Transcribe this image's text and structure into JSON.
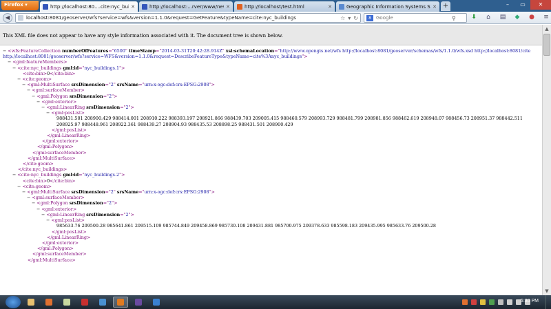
{
  "browser": {
    "app_button": "Firefox",
    "tabs": [
      {
        "label": "http://localhost:80....cite:nyc_buildings",
        "active": true,
        "color": "#3355bb"
      },
      {
        "label": "http://localhost:...rver/www/new.html",
        "active": false,
        "color": "#3355bb"
      },
      {
        "label": "http://localhost/test.html",
        "active": false,
        "color": "#e06020"
      },
      {
        "label": "Geographic Information Systems Stac...",
        "active": false,
        "color": "#5a8ad0"
      }
    ],
    "new_tab": "+",
    "url_host": "localhost",
    "url_rest": ":8081/geoserver/wfs?service=wfs&version=1.1.0&request=GetFeature&typeName=cite:nyc_buildings",
    "search_placeholder": "Google",
    "search_engine_letter": "8"
  },
  "info_message": "This XML file does not appear to have any style information associated with it. The document tree is shown below.",
  "xml_lines": [
    {
      "indent": 0,
      "minus": true,
      "wrap": true,
      "parts": [
        {
          "c": "tg",
          "t": "<wfs:FeatureCollection "
        },
        {
          "c": "an",
          "t": "numberOfFeatures"
        },
        {
          "c": "tg",
          "t": "=\""
        },
        {
          "c": "av",
          "t": "6500"
        },
        {
          "c": "tg",
          "t": "\" "
        },
        {
          "c": "an",
          "t": "timeStamp"
        },
        {
          "c": "tg",
          "t": "=\""
        },
        {
          "c": "av",
          "t": "2014-03-31T20:42:28.914Z"
        },
        {
          "c": "tg",
          "t": "\" "
        },
        {
          "c": "an",
          "t": "xsi:schemaLocation"
        },
        {
          "c": "tg",
          "t": "=\""
        },
        {
          "c": "av",
          "t": "http://www.opengis.net/wfs http://localhost:8081/geoserver/schemas/wfs/1.1.0/wfs.xsd http://localhost:8081/cite http://localhost:8081/geoserver/wfs?service=WFS&version=1.1.0&request=DescribeFeatureType&typeName=cite%3Anyc_buildings"
        },
        {
          "c": "tg",
          "t": "\">"
        }
      ]
    },
    {
      "indent": 1,
      "minus": true,
      "parts": [
        {
          "c": "tg",
          "t": "<gml:featureMembers>"
        }
      ]
    },
    {
      "indent": 2,
      "minus": true,
      "parts": [
        {
          "c": "tg",
          "t": "<cite:nyc_buildings "
        },
        {
          "c": "an",
          "t": "gml:id"
        },
        {
          "c": "tg",
          "t": "=\""
        },
        {
          "c": "av",
          "t": "nyc_buildings.1"
        },
        {
          "c": "tg",
          "t": "\">"
        }
      ]
    },
    {
      "indent": 3,
      "minus": false,
      "parts": [
        {
          "c": "tg",
          "t": "<cite:bin>"
        },
        {
          "c": "tx",
          "t": "0"
        },
        {
          "c": "tg",
          "t": "</cite:bin>"
        }
      ]
    },
    {
      "indent": 3,
      "minus": true,
      "parts": [
        {
          "c": "tg",
          "t": "<cite:geom>"
        }
      ]
    },
    {
      "indent": 4,
      "minus": true,
      "parts": [
        {
          "c": "tg",
          "t": "<gml:MultiSurface "
        },
        {
          "c": "an",
          "t": "srsDimension"
        },
        {
          "c": "tg",
          "t": "=\""
        },
        {
          "c": "av",
          "t": "2"
        },
        {
          "c": "tg",
          "t": "\" "
        },
        {
          "c": "an",
          "t": "srsName"
        },
        {
          "c": "tg",
          "t": "=\""
        },
        {
          "c": "av",
          "t": "urn:x-ogc:def:crs:EPSG:2908"
        },
        {
          "c": "tg",
          "t": "\">"
        }
      ]
    },
    {
      "indent": 5,
      "minus": true,
      "parts": [
        {
          "c": "tg",
          "t": "<gml:surfaceMember>"
        }
      ]
    },
    {
      "indent": 6,
      "minus": true,
      "parts": [
        {
          "c": "tg",
          "t": "<gml:Polygon "
        },
        {
          "c": "an",
          "t": "srsDimension"
        },
        {
          "c": "tg",
          "t": "=\""
        },
        {
          "c": "av",
          "t": "2"
        },
        {
          "c": "tg",
          "t": "\">"
        }
      ]
    },
    {
      "indent": 7,
      "minus": true,
      "parts": [
        {
          "c": "tg",
          "t": "<gml:exterior>"
        }
      ]
    },
    {
      "indent": 8,
      "minus": true,
      "parts": [
        {
          "c": "tg",
          "t": "<gml:LinearRing "
        },
        {
          "c": "an",
          "t": "srsDimension"
        },
        {
          "c": "tg",
          "t": "=\""
        },
        {
          "c": "av",
          "t": "2"
        },
        {
          "c": "tg",
          "t": "\">"
        }
      ]
    },
    {
      "indent": 9,
      "minus": true,
      "parts": [
        {
          "c": "tg",
          "t": "<gml:posList>"
        }
      ]
    },
    {
      "indent": 10,
      "minus": false,
      "wrap": true,
      "parts": [
        {
          "c": "tx",
          "t": "988431.501 208900.429 988414.001 208910.222 988393.197 208921.866 988439.703 209005.415 988460.579 208993.729 988481.799 208981.856 988462.619 208948.07 988456.73 208951.37 988442.511 208925.97 988448.961 208922.361 988439.27 208904.93 988435.53 208898.25 988431.501 208900.429"
        }
      ]
    },
    {
      "indent": 9,
      "minus": false,
      "parts": [
        {
          "c": "tg",
          "t": "</gml:posList>"
        }
      ]
    },
    {
      "indent": 8,
      "minus": false,
      "parts": [
        {
          "c": "tg",
          "t": "</gml:LinearRing>"
        }
      ]
    },
    {
      "indent": 7,
      "minus": false,
      "parts": [
        {
          "c": "tg",
          "t": "</gml:exterior>"
        }
      ]
    },
    {
      "indent": 6,
      "minus": false,
      "parts": [
        {
          "c": "tg",
          "t": "</gml:Polygon>"
        }
      ]
    },
    {
      "indent": 5,
      "minus": false,
      "parts": [
        {
          "c": "tg",
          "t": "</gml:surfaceMember>"
        }
      ]
    },
    {
      "indent": 4,
      "minus": false,
      "parts": [
        {
          "c": "tg",
          "t": "</gml:MultiSurface>"
        }
      ]
    },
    {
      "indent": 3,
      "minus": false,
      "parts": [
        {
          "c": "tg",
          "t": "</cite:geom>"
        }
      ]
    },
    {
      "indent": 2,
      "minus": false,
      "parts": [
        {
          "c": "tg",
          "t": "</cite:nyc_buildings>"
        }
      ]
    },
    {
      "indent": 2,
      "minus": true,
      "parts": [
        {
          "c": "tg",
          "t": "<cite:nyc_buildings "
        },
        {
          "c": "an",
          "t": "gml:id"
        },
        {
          "c": "tg",
          "t": "=\""
        },
        {
          "c": "av",
          "t": "nyc_buildings.2"
        },
        {
          "c": "tg",
          "t": "\">"
        }
      ]
    },
    {
      "indent": 3,
      "minus": false,
      "parts": [
        {
          "c": "tg",
          "t": "<cite:bin>"
        },
        {
          "c": "tx",
          "t": "0"
        },
        {
          "c": "tg",
          "t": "</cite:bin>"
        }
      ]
    },
    {
      "indent": 3,
      "minus": true,
      "parts": [
        {
          "c": "tg",
          "t": "<cite:geom>"
        }
      ]
    },
    {
      "indent": 4,
      "minus": true,
      "parts": [
        {
          "c": "tg",
          "t": "<gml:MultiSurface "
        },
        {
          "c": "an",
          "t": "srsDimension"
        },
        {
          "c": "tg",
          "t": "=\""
        },
        {
          "c": "av",
          "t": "2"
        },
        {
          "c": "tg",
          "t": "\" "
        },
        {
          "c": "an",
          "t": "srsName"
        },
        {
          "c": "tg",
          "t": "=\""
        },
        {
          "c": "av",
          "t": "urn:x-ogc:def:crs:EPSG:2908"
        },
        {
          "c": "tg",
          "t": "\">"
        }
      ]
    },
    {
      "indent": 5,
      "minus": true,
      "parts": [
        {
          "c": "tg",
          "t": "<gml:surfaceMember>"
        }
      ]
    },
    {
      "indent": 6,
      "minus": true,
      "parts": [
        {
          "c": "tg",
          "t": "<gml:Polygon "
        },
        {
          "c": "an",
          "t": "srsDimension"
        },
        {
          "c": "tg",
          "t": "=\""
        },
        {
          "c": "av",
          "t": "2"
        },
        {
          "c": "tg",
          "t": "\">"
        }
      ]
    },
    {
      "indent": 7,
      "minus": true,
      "parts": [
        {
          "c": "tg",
          "t": "<gml:exterior>"
        }
      ]
    },
    {
      "indent": 8,
      "minus": true,
      "parts": [
        {
          "c": "tg",
          "t": "<gml:LinearRing "
        },
        {
          "c": "an",
          "t": "srsDimension"
        },
        {
          "c": "tg",
          "t": "=\""
        },
        {
          "c": "av",
          "t": "2"
        },
        {
          "c": "tg",
          "t": "\">"
        }
      ]
    },
    {
      "indent": 9,
      "minus": true,
      "parts": [
        {
          "c": "tg",
          "t": "<gml:posList>"
        }
      ]
    },
    {
      "indent": 10,
      "minus": false,
      "wrap": true,
      "parts": [
        {
          "c": "tx",
          "t": "985633.76 209500.28 985641.861 209515.109 985744.849 209458.869 985730.108 209431.881 985700.975 209378.633 985598.183 209435.995 985633.76 209500.28"
        }
      ]
    },
    {
      "indent": 9,
      "minus": false,
      "parts": [
        {
          "c": "tg",
          "t": "</gml:posList>"
        }
      ]
    },
    {
      "indent": 8,
      "minus": false,
      "parts": [
        {
          "c": "tg",
          "t": "</gml:LinearRing>"
        }
      ]
    },
    {
      "indent": 7,
      "minus": false,
      "parts": [
        {
          "c": "tg",
          "t": "</gml:exterior>"
        }
      ]
    },
    {
      "indent": 6,
      "minus": false,
      "parts": [
        {
          "c": "tg",
          "t": "</gml:Polygon>"
        }
      ]
    },
    {
      "indent": 5,
      "minus": false,
      "parts": [
        {
          "c": "tg",
          "t": "</gml:surfaceMember>"
        }
      ]
    },
    {
      "indent": 4,
      "minus": false,
      "parts": [
        {
          "c": "tg",
          "t": "</gml:MultiSurface>"
        }
      ]
    }
  ],
  "taskbar": {
    "apps": [
      {
        "name": "explorer-icon",
        "color": "#e8c070",
        "active": false
      },
      {
        "name": "media-player-icon",
        "color": "#e07030",
        "active": false
      },
      {
        "name": "notepad-icon",
        "color": "#c8d8a0",
        "active": false
      },
      {
        "name": "filezilla-icon",
        "color": "#c83030",
        "active": false
      },
      {
        "name": "chrome-icon",
        "color": "#4a90d0",
        "active": false
      },
      {
        "name": "firefox-icon",
        "color": "#e07a20",
        "active": true
      },
      {
        "name": "visual-studio-icon",
        "color": "#6a4aa0",
        "active": false
      },
      {
        "name": "ie-icon",
        "color": "#3a80d0",
        "active": false
      }
    ],
    "clock": "5:30 PM"
  }
}
